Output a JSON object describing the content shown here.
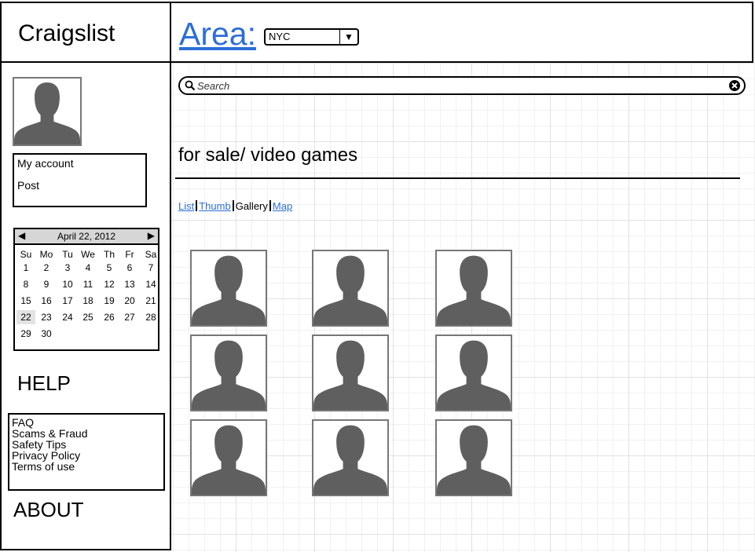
{
  "header": {
    "logo": "Craigslist",
    "area_label": "Area:",
    "area_select": {
      "selected": "NYC"
    }
  },
  "sidebar": {
    "account_menu": [
      "My account",
      "Post"
    ],
    "calendar": {
      "title": "April 22, 2012",
      "weekdays": [
        "Su",
        "Mo",
        "Tu",
        "We",
        "Th",
        "Fr",
        "Sa"
      ],
      "weeks": [
        [
          "1",
          "2",
          "3",
          "4",
          "5",
          "6",
          "7"
        ],
        [
          "8",
          "9",
          "10",
          "11",
          "12",
          "13",
          "14"
        ],
        [
          "15",
          "16",
          "17",
          "18",
          "19",
          "20",
          "21"
        ],
        [
          "22",
          "23",
          "24",
          "25",
          "26",
          "27",
          "28"
        ],
        [
          "29",
          "30",
          "",
          "",
          "",
          "",
          ""
        ]
      ],
      "selected_day": "22"
    },
    "help_heading": "HELP",
    "help_links": [
      "FAQ",
      "Scams & Fraud",
      "Safety Tips",
      "Privacy Policy",
      "Terms of use"
    ],
    "about_heading": "ABOUT"
  },
  "main": {
    "search": {
      "placeholder": "Search"
    },
    "title": "for sale/ video games",
    "view_modes": [
      {
        "label": "List",
        "active": false
      },
      {
        "label": "Thumb",
        "active": false
      },
      {
        "label": "Gallery",
        "active": true
      },
      {
        "label": "Map",
        "active": false
      }
    ],
    "gallery": {
      "rows": 3,
      "columns": 3,
      "icon": "person-placeholder-icon"
    }
  },
  "colors": {
    "link": "#2d6ed8",
    "placeholder_icon": "#5f5f5f"
  }
}
